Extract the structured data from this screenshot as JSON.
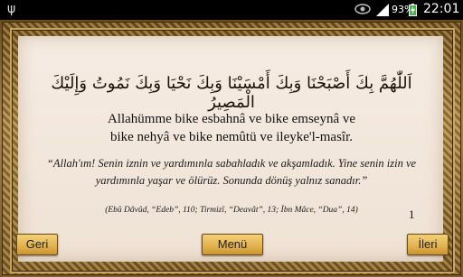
{
  "status_bar": {
    "usb_icon": "usb-icon",
    "eye_icon": "eye-icon",
    "signal_icon": "signal-icon",
    "battery_percent": "93%",
    "battery_icon": "battery-charging-icon",
    "time": "22:01"
  },
  "content": {
    "arabic": "اَللّٰهُمَّ بِكَ أَصْبَحْنَا وَبِكَ أَمْسَيْنَا وَبِكَ نَحْيَا وَبِكَ نَمُوتُ وَإِلَيْكَ الْمَصِيرُ",
    "transliteration_line1": "Allahümme bike esbahnâ ve bike emseynâ ve",
    "transliteration_line2": "bike nehyâ ve bike nemûtü ve ileyke'l-masîr.",
    "meaning_line1": "“Allah'ım! Senin iznin ve yardımınla sabahladık ve akşamladık. Yine senin izin ve",
    "meaning_line2": "yardımınla yaşar ve ölürüz. Sonunda dönüş yalnız sanadır.”",
    "source": "(Ebû Dâvûd, “Edeb”, 110; Tirmizî, “Deavât”, 13; İbn Mâce, “Dua”, 14)",
    "page_number": "1"
  },
  "buttons": {
    "back": "Geri",
    "menu": "Menü",
    "next": "İleri"
  },
  "colors": {
    "frame": "#8c6a2e",
    "panel": "#f3e8dd",
    "button": "#e2b14c"
  }
}
